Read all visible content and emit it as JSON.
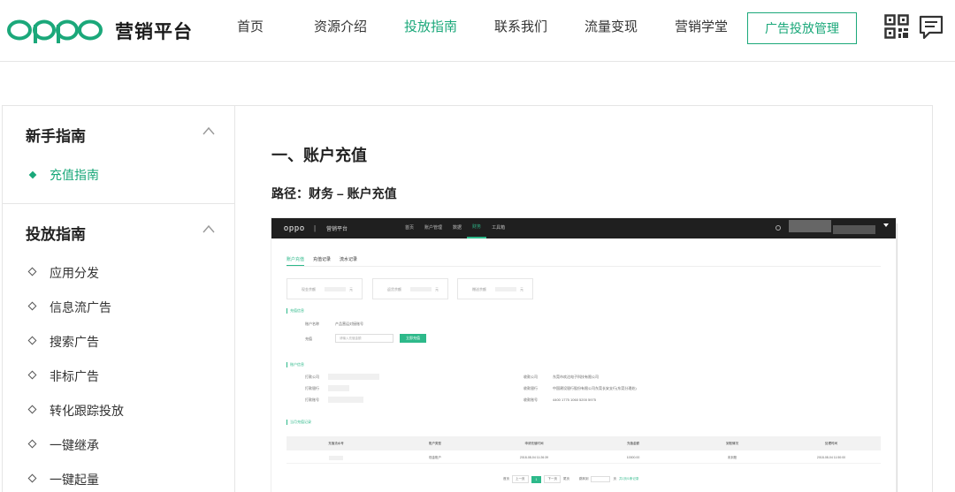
{
  "header": {
    "logo_text": "oppo",
    "brand": "营销平台",
    "nav": [
      "首页",
      "资源介绍",
      "投放指南",
      "联系我们",
      "流量变现",
      "营销学堂"
    ],
    "active_nav": "投放指南",
    "manage_button": "广告投放管理",
    "icons": [
      "qr-code-icon",
      "message-icon"
    ],
    "accent_color": "#1ba87a"
  },
  "sidebar": {
    "groups": [
      {
        "title": "新手指南",
        "items": [
          "充值指南"
        ],
        "active": "充值指南"
      },
      {
        "title": "投放指南",
        "items": [
          "应用分发",
          "信息流广告",
          "搜索广告",
          "非标广告",
          "转化跟踪投放",
          "一键继承",
          "一键起量"
        ]
      }
    ]
  },
  "main": {
    "section_title": "一、账户充值",
    "path": "路径：财务 – 账户充值"
  },
  "screenshot": {
    "logo": "oppo",
    "sep": "|",
    "brand": "营销平台",
    "nav": [
      "首页",
      "账户管理",
      "数据",
      "财务",
      "工具箱"
    ],
    "active_nav": "财务",
    "tabs": [
      "账户充值",
      "充值记录",
      "流水记录"
    ],
    "active_tab": "账户充值",
    "balances": [
      "现金余额",
      "返货余额",
      "赠送余额"
    ],
    "balance_unit": "元",
    "recharge_section": "充值信息",
    "account_name_label": "账户名称",
    "account_name_value": "产品营运对接账号",
    "amount_label": "充值",
    "amount_placeholder": "请输入充值金额",
    "recharge_button": "立即充值",
    "bank_section": "账户信息",
    "pay_labels": [
      "打款公司",
      "打款银行",
      "打款账号"
    ],
    "recv_labels": [
      "收款公司",
      "收款银行",
      "收款账号"
    ],
    "recv_values": [
      "东莞市欢达电子科技有限公司",
      "中国建设银行股份有限公司东莞长安支行(东莞分理处)",
      "4400 1775 1060 5200 5975"
    ],
    "record_section": "当月充值记录",
    "table_headers": [
      "充值流水号",
      "账户类型",
      "申请充值时间",
      "充值金额",
      "到账情况",
      "处理时间"
    ],
    "table_row": [
      "",
      "现金账户",
      "2018-08-04 11:26:39",
      "10000.00",
      "未到账",
      "2018-08-04 11:50:00"
    ],
    "pager": {
      "first": "首页",
      "prev": "上一页",
      "current": "1",
      "next": "下一页",
      "last": "尾页",
      "jump": "跳转到",
      "page_unit": "页",
      "total": "共1页/1条记录"
    }
  }
}
